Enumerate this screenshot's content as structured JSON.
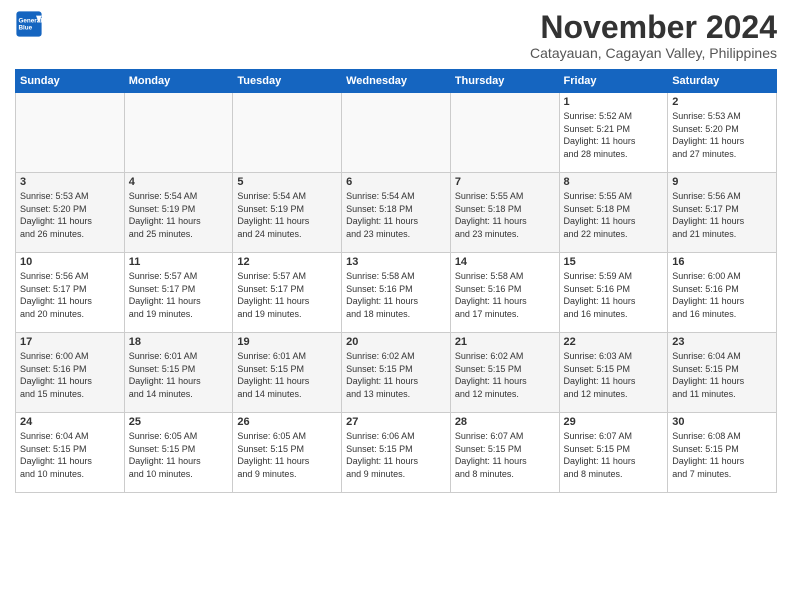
{
  "logo": {
    "line1": "General",
    "line2": "Blue"
  },
  "title": "November 2024",
  "location": "Catayauan, Cagayan Valley, Philippines",
  "weekdays": [
    "Sunday",
    "Monday",
    "Tuesday",
    "Wednesday",
    "Thursday",
    "Friday",
    "Saturday"
  ],
  "weeks": [
    [
      {
        "day": "",
        "info": ""
      },
      {
        "day": "",
        "info": ""
      },
      {
        "day": "",
        "info": ""
      },
      {
        "day": "",
        "info": ""
      },
      {
        "day": "",
        "info": ""
      },
      {
        "day": "1",
        "info": "Sunrise: 5:52 AM\nSunset: 5:21 PM\nDaylight: 11 hours\nand 28 minutes."
      },
      {
        "day": "2",
        "info": "Sunrise: 5:53 AM\nSunset: 5:20 PM\nDaylight: 11 hours\nand 27 minutes."
      }
    ],
    [
      {
        "day": "3",
        "info": "Sunrise: 5:53 AM\nSunset: 5:20 PM\nDaylight: 11 hours\nand 26 minutes."
      },
      {
        "day": "4",
        "info": "Sunrise: 5:54 AM\nSunset: 5:19 PM\nDaylight: 11 hours\nand 25 minutes."
      },
      {
        "day": "5",
        "info": "Sunrise: 5:54 AM\nSunset: 5:19 PM\nDaylight: 11 hours\nand 24 minutes."
      },
      {
        "day": "6",
        "info": "Sunrise: 5:54 AM\nSunset: 5:18 PM\nDaylight: 11 hours\nand 23 minutes."
      },
      {
        "day": "7",
        "info": "Sunrise: 5:55 AM\nSunset: 5:18 PM\nDaylight: 11 hours\nand 23 minutes."
      },
      {
        "day": "8",
        "info": "Sunrise: 5:55 AM\nSunset: 5:18 PM\nDaylight: 11 hours\nand 22 minutes."
      },
      {
        "day": "9",
        "info": "Sunrise: 5:56 AM\nSunset: 5:17 PM\nDaylight: 11 hours\nand 21 minutes."
      }
    ],
    [
      {
        "day": "10",
        "info": "Sunrise: 5:56 AM\nSunset: 5:17 PM\nDaylight: 11 hours\nand 20 minutes."
      },
      {
        "day": "11",
        "info": "Sunrise: 5:57 AM\nSunset: 5:17 PM\nDaylight: 11 hours\nand 19 minutes."
      },
      {
        "day": "12",
        "info": "Sunrise: 5:57 AM\nSunset: 5:17 PM\nDaylight: 11 hours\nand 19 minutes."
      },
      {
        "day": "13",
        "info": "Sunrise: 5:58 AM\nSunset: 5:16 PM\nDaylight: 11 hours\nand 18 minutes."
      },
      {
        "day": "14",
        "info": "Sunrise: 5:58 AM\nSunset: 5:16 PM\nDaylight: 11 hours\nand 17 minutes."
      },
      {
        "day": "15",
        "info": "Sunrise: 5:59 AM\nSunset: 5:16 PM\nDaylight: 11 hours\nand 16 minutes."
      },
      {
        "day": "16",
        "info": "Sunrise: 6:00 AM\nSunset: 5:16 PM\nDaylight: 11 hours\nand 16 minutes."
      }
    ],
    [
      {
        "day": "17",
        "info": "Sunrise: 6:00 AM\nSunset: 5:16 PM\nDaylight: 11 hours\nand 15 minutes."
      },
      {
        "day": "18",
        "info": "Sunrise: 6:01 AM\nSunset: 5:15 PM\nDaylight: 11 hours\nand 14 minutes."
      },
      {
        "day": "19",
        "info": "Sunrise: 6:01 AM\nSunset: 5:15 PM\nDaylight: 11 hours\nand 14 minutes."
      },
      {
        "day": "20",
        "info": "Sunrise: 6:02 AM\nSunset: 5:15 PM\nDaylight: 11 hours\nand 13 minutes."
      },
      {
        "day": "21",
        "info": "Sunrise: 6:02 AM\nSunset: 5:15 PM\nDaylight: 11 hours\nand 12 minutes."
      },
      {
        "day": "22",
        "info": "Sunrise: 6:03 AM\nSunset: 5:15 PM\nDaylight: 11 hours\nand 12 minutes."
      },
      {
        "day": "23",
        "info": "Sunrise: 6:04 AM\nSunset: 5:15 PM\nDaylight: 11 hours\nand 11 minutes."
      }
    ],
    [
      {
        "day": "24",
        "info": "Sunrise: 6:04 AM\nSunset: 5:15 PM\nDaylight: 11 hours\nand 10 minutes."
      },
      {
        "day": "25",
        "info": "Sunrise: 6:05 AM\nSunset: 5:15 PM\nDaylight: 11 hours\nand 10 minutes."
      },
      {
        "day": "26",
        "info": "Sunrise: 6:05 AM\nSunset: 5:15 PM\nDaylight: 11 hours\nand 9 minutes."
      },
      {
        "day": "27",
        "info": "Sunrise: 6:06 AM\nSunset: 5:15 PM\nDaylight: 11 hours\nand 9 minutes."
      },
      {
        "day": "28",
        "info": "Sunrise: 6:07 AM\nSunset: 5:15 PM\nDaylight: 11 hours\nand 8 minutes."
      },
      {
        "day": "29",
        "info": "Sunrise: 6:07 AM\nSunset: 5:15 PM\nDaylight: 11 hours\nand 8 minutes."
      },
      {
        "day": "30",
        "info": "Sunrise: 6:08 AM\nSunset: 5:15 PM\nDaylight: 11 hours\nand 7 minutes."
      }
    ]
  ]
}
